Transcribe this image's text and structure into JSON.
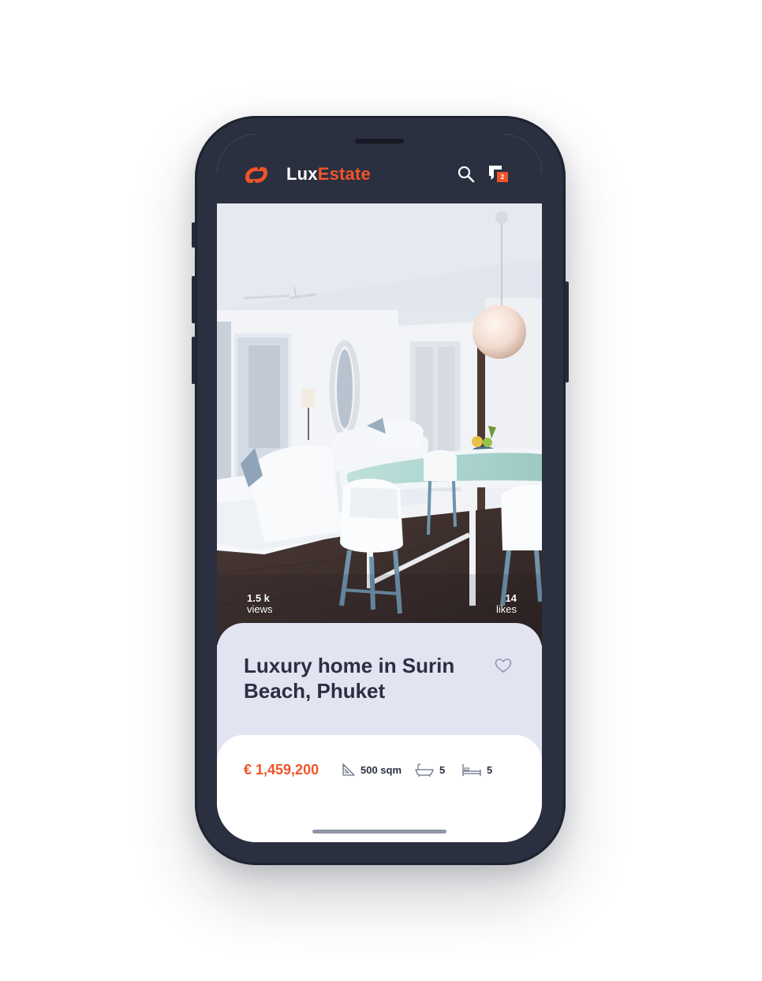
{
  "brand": {
    "part1": "Lux",
    "part2": "Estate"
  },
  "header": {
    "messages_count": "2"
  },
  "listing": {
    "views": {
      "value": "1.5 k",
      "label": "views"
    },
    "likes": {
      "value": "14",
      "label": "likes"
    },
    "title": "Luxury home in Surin Beach, Phuket",
    "price": "€ 1,459,200",
    "area": "500 sqm",
    "bathrooms": "5",
    "bedrooms": "5"
  },
  "icons": {
    "logo": "luxestate-logo-icon",
    "search": "search-icon",
    "messages": "chat-icon",
    "favorite": "heart-icon",
    "area": "ruler-triangle-icon",
    "bath": "bathtub-icon",
    "bed": "bed-icon"
  },
  "colors": {
    "accent": "#f0542a",
    "header": "#2b3040",
    "card": "#e2e4f1",
    "text": "#2b3040"
  }
}
